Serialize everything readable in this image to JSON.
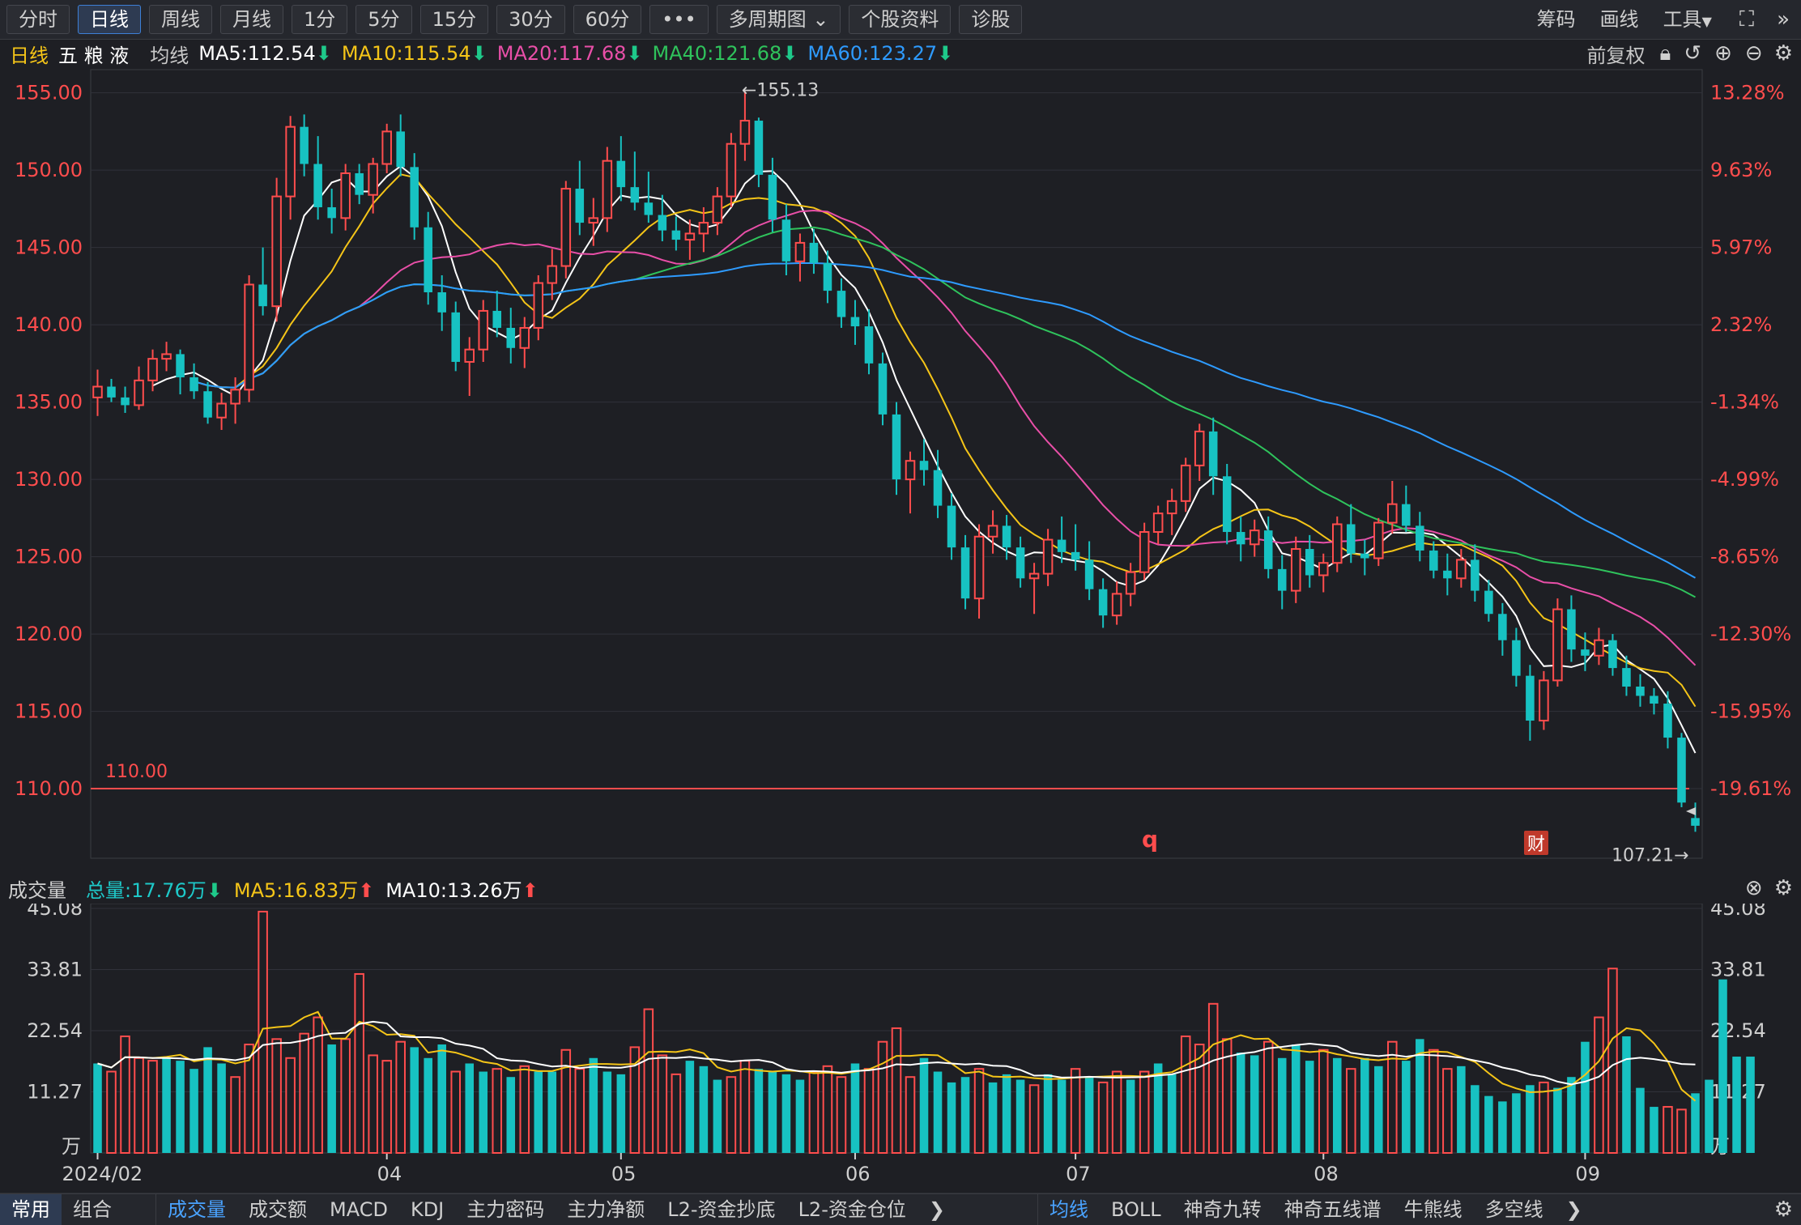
{
  "toolbar": {
    "periods": [
      "分时",
      "日线",
      "周线",
      "月线",
      "1分",
      "5分",
      "15分",
      "30分",
      "60分"
    ],
    "active_period": "日线",
    "more": "•••",
    "multi_period": "多周期图",
    "profile": "个股资料",
    "diagnose": "诊股",
    "right": [
      "筹码",
      "画线",
      "工具"
    ]
  },
  "infobar": {
    "period": "日线",
    "stock_name": "五 粮 液",
    "ma_label": "均线",
    "ma": [
      {
        "label": "MA5:112.54",
        "color": "#ffffff",
        "dir": "down"
      },
      {
        "label": "MA10:115.54",
        "color": "#f5c518",
        "dir": "down"
      },
      {
        "label": "MA20:117.68",
        "color": "#e94fa8",
        "dir": "down"
      },
      {
        "label": "MA40:121.68",
        "color": "#2fc35c",
        "dir": "down"
      },
      {
        "label": "MA60:123.27",
        "color": "#2e9bff",
        "dir": "down"
      }
    ],
    "adjust": "前复权"
  },
  "volbar": {
    "title": "成交量",
    "items": [
      {
        "label": "总量:17.76万",
        "color": "#1ec9c9",
        "dir": "down"
      },
      {
        "label": "MA5:16.83万",
        "color": "#f5c518",
        "dir": "up"
      },
      {
        "label": "MA10:13.26万",
        "color": "#ffffff",
        "dir": "up"
      }
    ]
  },
  "bottombar": {
    "left": [
      "常用",
      "组合"
    ],
    "indicators": [
      "成交量",
      "成交额",
      "MACD",
      "KDJ",
      "主力密码",
      "主力净额",
      "L2-资金抄底",
      "L2-资金仓位"
    ],
    "overlays": [
      "均线",
      "BOLL",
      "神奇九转",
      "神奇五线谱",
      "牛熊线",
      "多空线"
    ]
  },
  "chart_data": {
    "type": "candlestick",
    "price_axis": {
      "min": 105.5,
      "max": 156.5,
      "ticks": [
        155,
        150,
        145,
        140,
        135,
        130,
        125,
        120,
        115,
        110
      ],
      "tick_labels": [
        "155.00",
        "150.00",
        "145.00",
        "140.00",
        "135.00",
        "130.00",
        "125.00",
        "120.00",
        "115.00",
        "110.00"
      ],
      "right_labels": [
        "13.28%",
        "9.63%",
        "5.97%",
        "2.32%",
        "-1.34%",
        "-4.99%",
        "-8.65%",
        "-12.30%",
        "-15.95%",
        "-19.61%"
      ]
    },
    "volume_axis": {
      "max": 45.08,
      "ticks": [
        45.08,
        33.81,
        22.54,
        11.27
      ],
      "tick_labels": [
        "45.08",
        "33.81",
        "22.54",
        "11.27"
      ],
      "unit": "万"
    },
    "x_labels": [
      {
        "label": "2024/02",
        "index": 0
      },
      {
        "label": "04",
        "index": 21
      },
      {
        "label": "05",
        "index": 38
      },
      {
        "label": "06",
        "index": 55
      },
      {
        "label": "07",
        "index": 71
      },
      {
        "label": "08",
        "index": 89
      },
      {
        "label": "09",
        "index": 108
      }
    ],
    "annotations": {
      "high_label": "←155.13",
      "high_value": 155.13,
      "low_label": "107.21→",
      "low_value": 107.21,
      "hline_label": "110.00",
      "hline_value": 110.0,
      "event_q": "q",
      "event_cai": "财"
    },
    "series_names": [
      "MA5",
      "MA10",
      "MA20",
      "MA40",
      "MA60"
    ],
    "candles": [
      [
        135.3,
        137.1,
        134.1,
        136.0
      ],
      [
        136.0,
        136.5,
        135.0,
        135.3
      ],
      [
        135.3,
        136.0,
        134.3,
        134.8
      ],
      [
        134.8,
        137.3,
        134.5,
        136.4
      ],
      [
        136.4,
        138.4,
        135.7,
        137.8
      ],
      [
        137.8,
        138.9,
        137.0,
        138.1
      ],
      [
        138.1,
        138.4,
        135.5,
        136.6
      ],
      [
        136.6,
        137.5,
        135.2,
        135.7
      ],
      [
        135.7,
        136.3,
        133.6,
        134.0
      ],
      [
        134.0,
        135.6,
        133.2,
        134.9
      ],
      [
        134.9,
        136.6,
        133.6,
        135.8
      ],
      [
        135.8,
        143.2,
        135.0,
        142.6
      ],
      [
        142.6,
        145.0,
        140.6,
        141.2
      ],
      [
        141.2,
        149.5,
        140.2,
        148.3
      ],
      [
        148.3,
        153.5,
        146.8,
        152.8
      ],
      [
        152.8,
        153.6,
        149.6,
        150.4
      ],
      [
        150.4,
        152.2,
        146.8,
        147.6
      ],
      [
        147.6,
        148.8,
        145.9,
        146.9
      ],
      [
        146.9,
        150.4,
        146.1,
        149.8
      ],
      [
        149.8,
        150.4,
        147.8,
        148.4
      ],
      [
        148.4,
        150.8,
        147.2,
        150.4
      ],
      [
        150.4,
        153.0,
        149.8,
        152.5
      ],
      [
        152.5,
        153.6,
        149.6,
        150.2
      ],
      [
        150.2,
        151.1,
        145.5,
        146.3
      ],
      [
        146.3,
        147.3,
        141.3,
        142.1
      ],
      [
        142.1,
        143.2,
        139.6,
        140.8
      ],
      [
        140.8,
        141.5,
        137.0,
        137.6
      ],
      [
        137.6,
        139.2,
        135.4,
        138.4
      ],
      [
        138.4,
        141.6,
        137.6,
        140.9
      ],
      [
        140.9,
        142.2,
        139.2,
        139.8
      ],
      [
        139.8,
        141.1,
        137.5,
        138.5
      ],
      [
        138.5,
        140.5,
        137.2,
        139.8
      ],
      [
        139.8,
        143.2,
        139.0,
        142.7
      ],
      [
        142.7,
        144.9,
        141.6,
        143.8
      ],
      [
        143.8,
        149.3,
        143.0,
        148.8
      ],
      [
        148.8,
        150.6,
        145.8,
        146.6
      ],
      [
        146.6,
        148.2,
        145.1,
        146.9
      ],
      [
        146.9,
        151.5,
        146.0,
        150.6
      ],
      [
        150.6,
        152.2,
        148.0,
        148.9
      ],
      [
        148.9,
        151.2,
        147.4,
        147.9
      ],
      [
        147.9,
        149.9,
        146.6,
        147.1
      ],
      [
        147.1,
        148.4,
        145.4,
        146.1
      ],
      [
        146.1,
        147.0,
        144.8,
        145.5
      ],
      [
        145.5,
        146.8,
        144.2,
        145.9
      ],
      [
        145.9,
        147.6,
        144.7,
        146.6
      ],
      [
        146.6,
        148.9,
        145.8,
        148.3
      ],
      [
        148.3,
        152.4,
        147.6,
        151.7
      ],
      [
        151.7,
        155.1,
        150.6,
        153.2
      ],
      [
        153.2,
        153.4,
        148.9,
        149.7
      ],
      [
        149.7,
        150.8,
        146.0,
        146.8
      ],
      [
        146.8,
        147.8,
        143.2,
        144.1
      ],
      [
        144.1,
        145.9,
        142.8,
        145.3
      ],
      [
        145.3,
        146.2,
        143.3,
        144.0
      ],
      [
        144.0,
        144.8,
        141.4,
        142.2
      ],
      [
        142.2,
        143.0,
        139.8,
        140.5
      ],
      [
        140.5,
        141.6,
        138.7,
        139.9
      ],
      [
        139.9,
        141.0,
        136.8,
        137.5
      ],
      [
        137.5,
        138.2,
        133.5,
        134.2
      ],
      [
        134.2,
        135.0,
        129.0,
        130.0
      ],
      [
        130.0,
        131.8,
        127.8,
        131.2
      ],
      [
        131.2,
        132.6,
        129.6,
        130.6
      ],
      [
        130.6,
        131.9,
        127.5,
        128.3
      ],
      [
        128.3,
        129.1,
        124.8,
        125.6
      ],
      [
        125.6,
        126.4,
        121.6,
        122.3
      ],
      [
        122.3,
        127.1,
        121.0,
        126.3
      ],
      [
        126.3,
        128.0,
        125.2,
        127.0
      ],
      [
        127.0,
        127.7,
        124.8,
        125.6
      ],
      [
        125.6,
        126.3,
        123.0,
        123.6
      ],
      [
        123.6,
        124.6,
        121.3,
        123.9
      ],
      [
        123.9,
        126.8,
        123.1,
        126.1
      ],
      [
        126.1,
        127.6,
        124.6,
        125.3
      ],
      [
        125.3,
        127.1,
        124.1,
        124.8
      ],
      [
        124.8,
        126.0,
        122.2,
        122.9
      ],
      [
        122.9,
        123.6,
        120.4,
        121.2
      ],
      [
        121.2,
        123.4,
        120.6,
        122.6
      ],
      [
        122.6,
        124.6,
        121.8,
        124.0
      ],
      [
        124.0,
        127.2,
        123.5,
        126.6
      ],
      [
        126.6,
        128.3,
        125.8,
        127.8
      ],
      [
        127.8,
        129.4,
        126.4,
        128.6
      ],
      [
        128.6,
        131.4,
        127.9,
        130.9
      ],
      [
        130.9,
        133.6,
        129.9,
        133.1
      ],
      [
        133.1,
        134.0,
        129.0,
        130.2
      ],
      [
        130.2,
        131.0,
        125.8,
        126.6
      ],
      [
        126.6,
        127.6,
        124.7,
        125.8
      ],
      [
        125.8,
        127.4,
        125.0,
        126.7
      ],
      [
        126.7,
        127.6,
        123.6,
        124.2
      ],
      [
        124.2,
        125.1,
        121.6,
        122.8
      ],
      [
        122.8,
        126.3,
        122.0,
        125.5
      ],
      [
        125.5,
        126.4,
        123.0,
        123.8
      ],
      [
        123.8,
        125.2,
        122.7,
        124.6
      ],
      [
        124.6,
        127.6,
        124.0,
        127.1
      ],
      [
        127.1,
        128.4,
        124.6,
        125.2
      ],
      [
        125.2,
        126.1,
        123.8,
        124.9
      ],
      [
        124.9,
        127.5,
        124.4,
        127.2
      ],
      [
        127.2,
        129.9,
        126.5,
        128.4
      ],
      [
        128.4,
        129.6,
        126.6,
        127.0
      ],
      [
        127.0,
        127.9,
        124.7,
        125.4
      ],
      [
        125.4,
        126.0,
        123.6,
        124.1
      ],
      [
        124.1,
        125.2,
        122.5,
        123.6
      ],
      [
        123.6,
        125.5,
        123.0,
        124.8
      ],
      [
        124.8,
        125.8,
        122.1,
        122.8
      ],
      [
        122.8,
        123.5,
        120.8,
        121.3
      ],
      [
        121.3,
        122.0,
        118.6,
        119.6
      ],
      [
        119.6,
        120.4,
        116.6,
        117.3
      ],
      [
        117.3,
        118.0,
        113.1,
        114.4
      ],
      [
        114.4,
        117.6,
        113.8,
        117.0
      ],
      [
        117.0,
        122.3,
        116.6,
        121.6
      ],
      [
        121.6,
        122.5,
        118.2,
        119.0
      ],
      [
        119.0,
        120.1,
        117.6,
        118.6
      ],
      [
        118.6,
        120.4,
        118.0,
        119.6
      ],
      [
        119.6,
        120.0,
        117.3,
        117.8
      ],
      [
        117.8,
        118.6,
        116.0,
        116.6
      ],
      [
        116.6,
        117.4,
        115.3,
        116.0
      ],
      [
        116.0,
        116.5,
        114.8,
        115.5
      ],
      [
        115.5,
        116.3,
        112.6,
        113.3
      ],
      [
        113.3,
        113.6,
        108.8,
        109.1
      ],
      [
        108.1,
        109.1,
        107.21,
        107.6
      ]
    ],
    "volumes": [
      [
        16.5,
        0
      ],
      [
        15.0,
        1
      ],
      [
        21.5,
        1
      ],
      [
        17.5,
        1
      ],
      [
        17.0,
        1
      ],
      [
        17.5,
        0
      ],
      [
        17.0,
        0
      ],
      [
        15.5,
        0
      ],
      [
        19.5,
        0
      ],
      [
        16.5,
        0
      ],
      [
        14.0,
        1
      ],
      [
        20.0,
        1
      ],
      [
        44.5,
        1
      ],
      [
        21.0,
        1
      ],
      [
        17.5,
        1
      ],
      [
        22.0,
        1
      ],
      [
        25.0,
        1
      ],
      [
        20.0,
        0
      ],
      [
        21.0,
        1
      ],
      [
        33.0,
        1
      ],
      [
        18.0,
        1
      ],
      [
        17.0,
        1
      ],
      [
        20.5,
        1
      ],
      [
        19.5,
        0
      ],
      [
        17.5,
        0
      ],
      [
        20.0,
        0
      ],
      [
        15.0,
        1
      ],
      [
        16.5,
        0
      ],
      [
        15.0,
        0
      ],
      [
        15.5,
        1
      ],
      [
        14.0,
        0
      ],
      [
        16.0,
        1
      ],
      [
        15.0,
        0
      ],
      [
        15.0,
        0
      ],
      [
        19.0,
        1
      ],
      [
        15.5,
        1
      ],
      [
        17.5,
        0
      ],
      [
        15.0,
        0
      ],
      [
        14.5,
        0
      ],
      [
        19.5,
        1
      ],
      [
        26.5,
        1
      ],
      [
        18.0,
        1
      ],
      [
        14.5,
        1
      ],
      [
        17.0,
        0
      ],
      [
        16.0,
        0
      ],
      [
        13.5,
        0
      ],
      [
        14.0,
        1
      ],
      [
        17.0,
        1
      ],
      [
        15.5,
        0
      ],
      [
        15.0,
        0
      ],
      [
        14.5,
        0
      ],
      [
        13.5,
        0
      ],
      [
        15.0,
        1
      ],
      [
        16.0,
        1
      ],
      [
        14.0,
        1
      ],
      [
        16.5,
        0
      ],
      [
        15.5,
        1
      ],
      [
        20.5,
        1
      ],
      [
        23.0,
        1
      ],
      [
        14.0,
        1
      ],
      [
        17.5,
        0
      ],
      [
        15.0,
        0
      ],
      [
        13.0,
        0
      ],
      [
        14.0,
        0
      ],
      [
        15.5,
        1
      ],
      [
        13.0,
        0
      ],
      [
        14.5,
        0
      ],
      [
        13.5,
        0
      ],
      [
        12.5,
        1
      ],
      [
        14.5,
        0
      ],
      [
        13.5,
        0
      ],
      [
        15.5,
        1
      ],
      [
        14.0,
        0
      ],
      [
        13.0,
        1
      ],
      [
        15.0,
        1
      ],
      [
        13.5,
        0
      ],
      [
        15.0,
        1
      ],
      [
        16.5,
        0
      ],
      [
        14.5,
        0
      ],
      [
        21.5,
        1
      ],
      [
        20.0,
        1
      ],
      [
        27.5,
        1
      ],
      [
        21.0,
        1
      ],
      [
        18.5,
        0
      ],
      [
        18.0,
        0
      ],
      [
        20.5,
        1
      ],
      [
        17.5,
        0
      ],
      [
        20.0,
        0
      ],
      [
        17.0,
        0
      ],
      [
        19.0,
        1
      ],
      [
        17.5,
        0
      ],
      [
        15.5,
        1
      ],
      [
        17.5,
        0
      ],
      [
        16.0,
        0
      ],
      [
        20.5,
        1
      ],
      [
        17.0,
        0
      ],
      [
        21.0,
        0
      ],
      [
        19.0,
        1
      ],
      [
        15.5,
        1
      ],
      [
        16.0,
        0
      ],
      [
        12.5,
        0
      ],
      [
        10.5,
        0
      ],
      [
        9.5,
        0
      ],
      [
        11.0,
        0
      ],
      [
        12.5,
        0
      ],
      [
        13.0,
        1
      ],
      [
        12.0,
        0
      ],
      [
        14.0,
        0
      ],
      [
        20.5,
        0
      ],
      [
        25.0,
        1
      ],
      [
        34.0,
        1
      ],
      [
        21.5,
        0
      ],
      [
        12.0,
        0
      ],
      [
        8.5,
        0
      ],
      [
        8.5,
        1
      ],
      [
        8.0,
        1
      ],
      [
        11.0,
        0
      ],
      [
        13.5,
        0
      ],
      [
        32.0,
        0
      ],
      [
        17.76,
        0
      ],
      [
        17.76,
        0
      ]
    ]
  }
}
